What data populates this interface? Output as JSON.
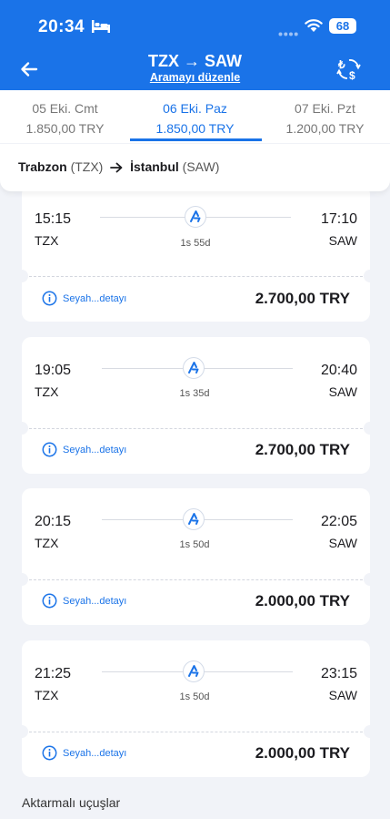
{
  "status": {
    "time": "20:34",
    "battery": "68"
  },
  "header": {
    "title": "TZX → SAW",
    "edit_label": "Aramayı düzenle"
  },
  "dates": [
    {
      "date": "05 Eki. Cmt",
      "price": "1.850,00 TRY"
    },
    {
      "date": "06 Eki. Paz",
      "price": "1.850,00 TRY"
    },
    {
      "date": "07 Eki. Pzt",
      "price": "1.200,00 TRY"
    }
  ],
  "route": {
    "from_city": "Trabzon",
    "from_code": "(TZX)",
    "to_city": "İstanbul",
    "to_code": "(SAW)"
  },
  "flights": [
    {
      "dep": "15:15",
      "arr": "17:10",
      "from": "TZX",
      "to": "SAW",
      "duration": "1s 55d",
      "detail": "Seyah...detayı",
      "price": "2.700,00 TRY"
    },
    {
      "dep": "19:05",
      "arr": "20:40",
      "from": "TZX",
      "to": "SAW",
      "duration": "1s 35d",
      "detail": "Seyah...detayı",
      "price": "2.700,00 TRY"
    },
    {
      "dep": "20:15",
      "arr": "22:05",
      "from": "TZX",
      "to": "SAW",
      "duration": "1s 50d",
      "detail": "Seyah...detayı",
      "price": "2.000,00 TRY"
    },
    {
      "dep": "21:25",
      "arr": "23:15",
      "from": "TZX",
      "to": "SAW",
      "duration": "1s 50d",
      "detail": "Seyah...detayı",
      "price": "2.000,00 TRY"
    }
  ],
  "footer": {
    "connecting_label": "Aktarmalı uçuşlar"
  },
  "colors": {
    "brand": "#1a73e8",
    "background": "#f1f3f8"
  },
  "icons": [
    "bed-icon",
    "wifi-icon",
    "back-arrow-icon",
    "currency-exchange-icon",
    "airline-logo-icon",
    "info-icon"
  ]
}
